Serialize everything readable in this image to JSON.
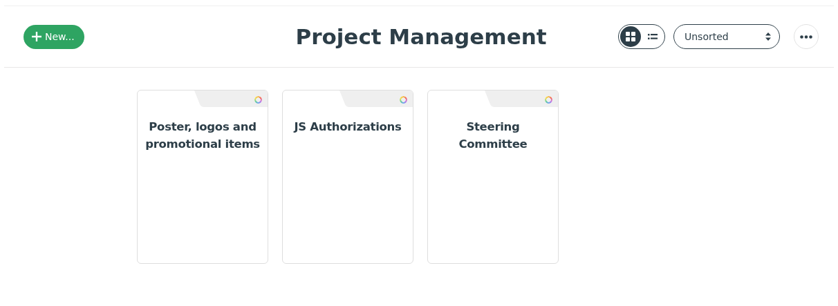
{
  "new_button": {
    "label": "New..."
  },
  "title": "Project Management",
  "view_toggle": [
    {
      "kind": "grid",
      "selected": true
    },
    {
      "kind": "list",
      "selected": false
    }
  ],
  "sort": {
    "value": "Unsorted"
  },
  "cards": [
    {
      "title": "Poster, logos and promotional items"
    },
    {
      "title": "JS Authorizations"
    },
    {
      "title": "Steering Committee"
    }
  ]
}
